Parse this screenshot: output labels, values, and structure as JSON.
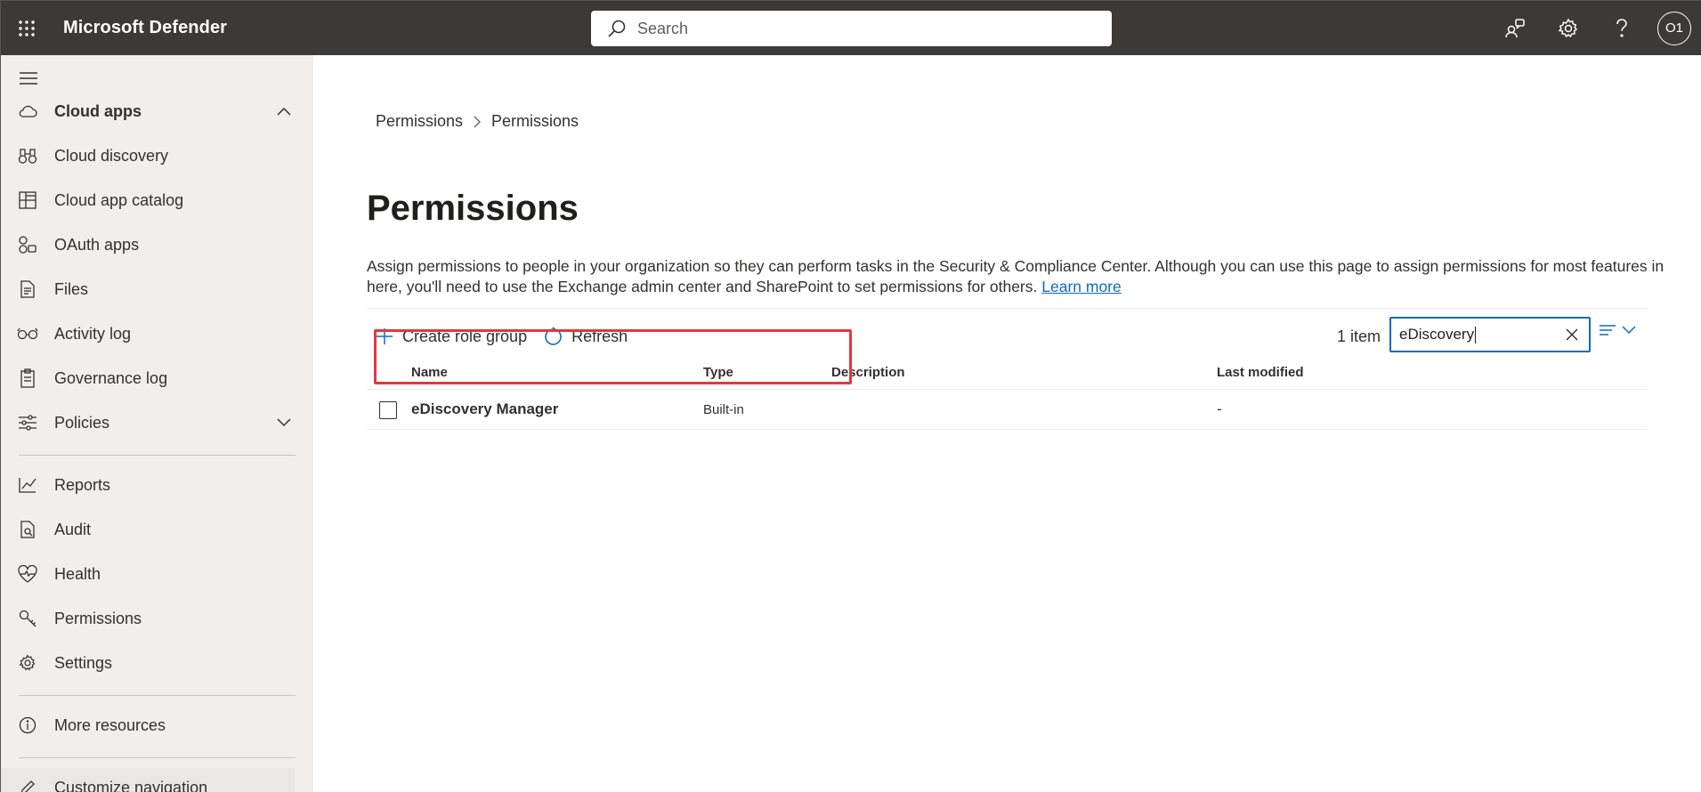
{
  "app": {
    "title": "Microsoft Defender"
  },
  "search": {
    "placeholder": "Search"
  },
  "user": {
    "initials": "O1"
  },
  "sidebar": {
    "items": [
      {
        "label": "Cloud apps",
        "icon": "cloud-icon"
      },
      {
        "label": "Cloud discovery",
        "icon": "binoculars-icon"
      },
      {
        "label": "Cloud app catalog",
        "icon": "catalog-icon"
      },
      {
        "label": "OAuth apps",
        "icon": "oauth-icon"
      },
      {
        "label": "Files",
        "icon": "file-icon"
      },
      {
        "label": "Activity log",
        "icon": "glasses-icon"
      },
      {
        "label": "Governance log",
        "icon": "clipboard-icon"
      },
      {
        "label": "Policies",
        "icon": "sliders-icon"
      },
      {
        "label": "Reports",
        "icon": "chart-icon"
      },
      {
        "label": "Audit",
        "icon": "audit-icon"
      },
      {
        "label": "Health",
        "icon": "heart-icon"
      },
      {
        "label": "Permissions",
        "icon": "key-icon"
      },
      {
        "label": "Settings",
        "icon": "gear-icon"
      },
      {
        "label": "More resources",
        "icon": "info-icon"
      },
      {
        "label": "Customize navigation",
        "icon": "pencil-icon"
      }
    ]
  },
  "main": {
    "breadcrumb": [
      "Permissions",
      "Permissions"
    ],
    "title": "Permissions",
    "description": "Assign permissions to people in your organization so they can perform tasks in the Security & Compliance Center. Although you can use this page to assign permissions for most features in here, you'll need to use the Exchange admin center and SharePoint to set permissions for others.",
    "learn_more": "Learn more",
    "commands": {
      "create": "Create role group",
      "refresh": "Refresh"
    },
    "item_count": "1 item",
    "filter_value": "eDiscovery",
    "columns": [
      "Name",
      "Type",
      "Description",
      "Last modified"
    ],
    "rows": [
      {
        "name": "eDiscovery Manager",
        "type": "Built-in",
        "description": "",
        "last_modified": "-"
      }
    ]
  },
  "colors": {
    "topbar": "#3b3a39",
    "accent": "#0f6cbd",
    "highlight": "#e0393e"
  }
}
